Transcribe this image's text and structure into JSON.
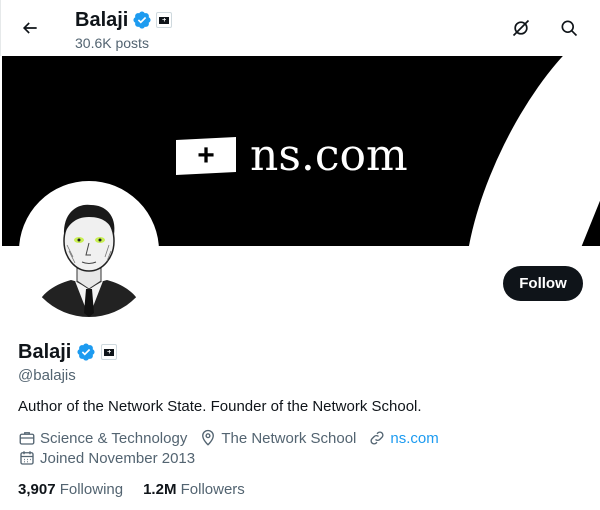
{
  "header": {
    "name": "Balaji",
    "posts": "30.6K posts"
  },
  "banner": {
    "flag_symbol": "+",
    "site": "ns.com"
  },
  "profile": {
    "name": "Balaji",
    "handle": "@balajis",
    "bio": "Author of the Network State. Founder of the Network School.",
    "category": "Science & Technology",
    "location": "The Network School",
    "website": "ns.com",
    "joined": "Joined November 2013",
    "following_count": "3,907",
    "following_label": "Following",
    "followers_count": "1.2M",
    "followers_label": "Followers"
  },
  "actions": {
    "follow_label": "Follow"
  },
  "colors": {
    "verified": "#1d9bf0",
    "link": "#1d9bf0",
    "follow_bg": "#0f1419"
  },
  "icons": [
    "back-arrow-icon",
    "verified-badge-icon",
    "affiliate-badge-icon",
    "no-audio-icon",
    "search-icon",
    "briefcase-icon",
    "location-pin-icon",
    "link-icon",
    "calendar-icon"
  ]
}
